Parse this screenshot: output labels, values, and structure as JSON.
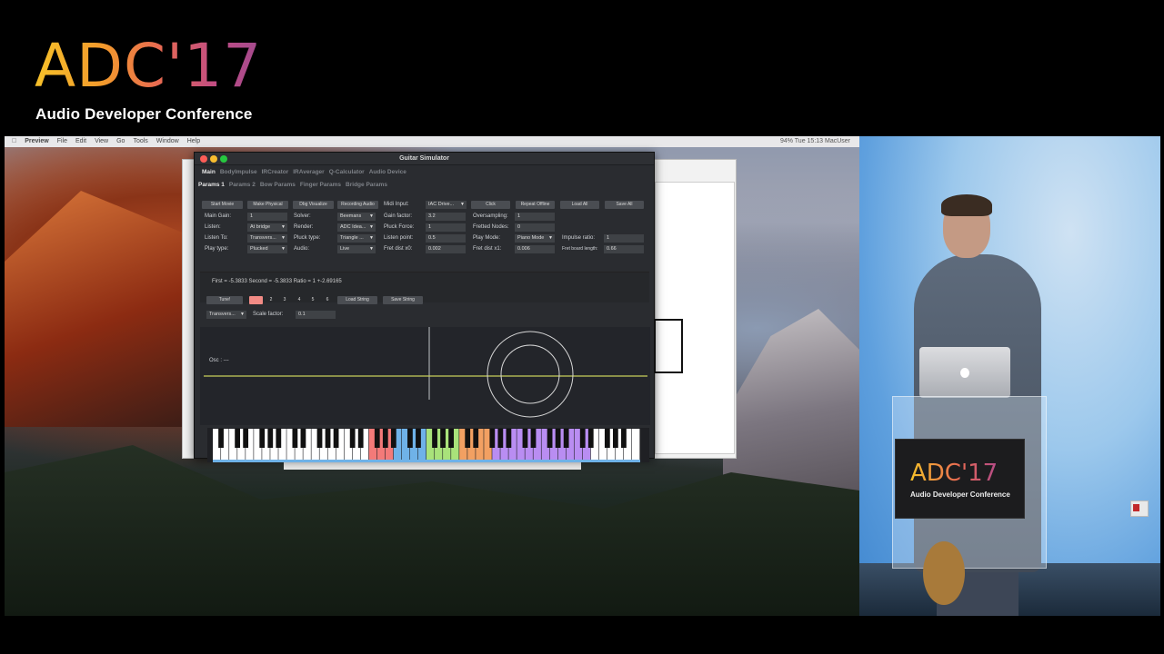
{
  "logo": {
    "title": "ADC'17",
    "subtitle": "Audio Developer Conference"
  },
  "menubar": {
    "items": [
      "Preview",
      "File",
      "Edit",
      "View",
      "Go",
      "Tools",
      "Window",
      "Help"
    ],
    "status": "94%  Tue 15:13  MacUser"
  },
  "window": {
    "title": "Guitar Simulator",
    "tabs": [
      "Main",
      "BodyImpulse",
      "IRCreator",
      "IRAverager",
      "Q-Calculator",
      "Audio Device"
    ],
    "subtabs": [
      "Params 1",
      "Params 2",
      "Bow Params",
      "Finger Params",
      "Bridge Params"
    ],
    "buttons": {
      "start_movie": "Start Movie",
      "make_physical": "Make Physical",
      "dbg_visualize": "Dbg Visualize",
      "recording_audio": "Recording Audio",
      "click": "Click",
      "repeat_offline": "Repeat Offline",
      "load_all": "Load All",
      "save_all": "Save All",
      "tune": "Tune!",
      "load_string": "Load String",
      "save_string": "Save String"
    },
    "params": {
      "midi_input_label": "Midi Input:",
      "midi_input_value": "IAC Drive...",
      "main_gain_label": "Main Gain:",
      "main_gain_value": "1",
      "solver_label": "Solver:",
      "solver_value": "Beemans",
      "gain_factor_label": "Gain factor:",
      "gain_factor_value": "3.2",
      "oversampling_label": "Oversampling:",
      "oversampling_value": "1",
      "listen_label": "Listen:",
      "listen_value": "At bridge",
      "render_label": "Render:",
      "render_value": "ADC Idea...",
      "pluck_force_label": "Pluck Force:",
      "pluck_force_value": "1",
      "fretted_nodes_label": "Fretted Nodes:",
      "fretted_nodes_value": "0",
      "listen_to_label": "Listen To:",
      "listen_to_value": "Transvers...",
      "pluck_type_label": "Pluck type:",
      "pluck_type_value": "Triangle ...",
      "listen_point_label": "Listen point:",
      "listen_point_value": "0.5",
      "play_mode_label": "Play Mode:",
      "play_mode_value": "Piano Mode",
      "impulse_ratio_label": "Impulse ratio:",
      "impulse_ratio_value": "1",
      "play_type_label": "Play type:",
      "play_type_value": "Plucked",
      "audio_label": "Audio:",
      "audio_value": "Live",
      "fret_dist_x0_label": "Fret dist x0:",
      "fret_dist_x0_value": "0.002",
      "fret_dist_x1_label": "Fret dist x1:",
      "fret_dist_x1_value": "0.006",
      "fret_board_length_label": "Fret board length:",
      "fret_board_length_value": "0.66"
    },
    "output": "First = -5.3833 Second = -5.3833 Ratio = 1  +-2.69165",
    "string_selector": [
      "1",
      "2",
      "3",
      "4",
      "5",
      "6"
    ],
    "viz": {
      "mode_value": "Transvers...",
      "scale_factor_label": "Scale factor:",
      "scale_factor_value": "0.1",
      "osc_label": "Osc : ---"
    }
  },
  "podium": {
    "title": "ADC'17",
    "subtitle": "Audio Developer Conference"
  },
  "colors": {
    "accent_pink": "#f28b85",
    "keyboard_red": "#f37a79",
    "keyboard_blue": "#6fb2e8",
    "keyboard_green": "#a9e27a",
    "keyboard_orange": "#f2a062",
    "keyboard_purple": "#b98df2",
    "wave_yellow": "#c8cf5a"
  }
}
